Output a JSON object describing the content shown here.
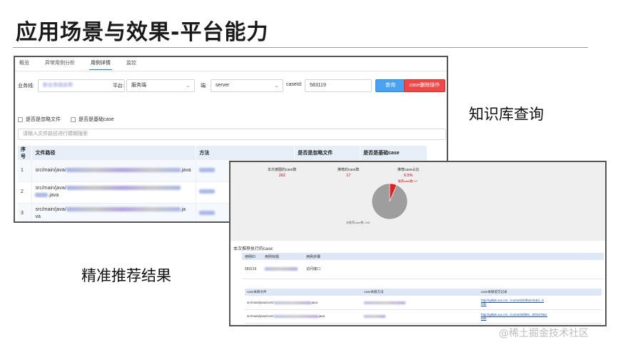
{
  "slide": {
    "title": "应用场景与效果-平台能力",
    "label_knowledge": "知识库查询",
    "label_recommend": "精准推荐结果",
    "watermark": "@稀土掘金技术社区"
  },
  "query_panel": {
    "tabs": [
      {
        "label": "概览"
      },
      {
        "label": "异常用例分析"
      },
      {
        "label": "用例详情",
        "active": true
      },
      {
        "label": "监控"
      }
    ],
    "filters": {
      "business_label": "业务线:",
      "business_value": "新业务线名称",
      "platform_label": "平台:",
      "platform_value": "服务端",
      "end_label": "端:",
      "end_value": "server",
      "caseid_label": "caseId:",
      "caseid_value": "583119",
      "query_button": "查询",
      "alert_button": "case删除操作"
    },
    "checkboxes": [
      "是否是忽略文件",
      "是否是基础case"
    ],
    "search_placeholder": "请输入文件路径进行模糊搜索",
    "table": {
      "headers": [
        "序号",
        "文件路径",
        "方法",
        "是否是忽略文件",
        "是否是基础case"
      ],
      "rows": [
        {
          "index": "1",
          "path_prefix": "src/main/java/",
          "path_suffix": ".java"
        },
        {
          "index": "2",
          "path_prefix": "src/main/java/",
          "path_suffix": ".java"
        },
        {
          "index": "3",
          "path_prefix": "src/main/java/",
          "path_suffix": ".ja",
          "path_suffix2": "va"
        }
      ]
    }
  },
  "result_panel": {
    "stats": [
      {
        "label": "本次被圈的case数",
        "value": "262"
      },
      {
        "label": "推荐的case数",
        "value": "17"
      },
      {
        "label": "推荐case占比",
        "value": "6.5%"
      }
    ],
    "pie_legend_small": "未推荐case数: 245",
    "pie_legend_red": "推荐case数: 17",
    "chart_data": {
      "type": "pie",
      "labels": [
        "推荐case数",
        "未推荐case数"
      ],
      "values": [
        17,
        245
      ],
      "colors": [
        "#e02020",
        "#9e9e9e"
      ]
    },
    "section_title": "本次推荐执行的case:",
    "case_table": {
      "headers": [
        "用例ID",
        "用例标题",
        "用例步骤"
      ],
      "row": {
        "id": "583119",
        "step": "访问接口"
      }
    },
    "detail_table": {
      "headers": [
        "case关联文件",
        "case关联方法",
        "case关联提交记录"
      ],
      "rows": [
        {
          "file_prefix": "src/main/java/com/",
          "file_suffix": ".java",
          "link": "http://gitlab.xxx.cn/.../commit/4f3b2e41bd...b",
          "link2": "63b"
        },
        {
          "file_prefix": "src/main/java/com/",
          "file_suffix": ".java",
          "link": "http://gitlab.xxx.cn/.../commit/5f6fe...0f20479ec",
          "link2": "beb"
        }
      ]
    }
  }
}
